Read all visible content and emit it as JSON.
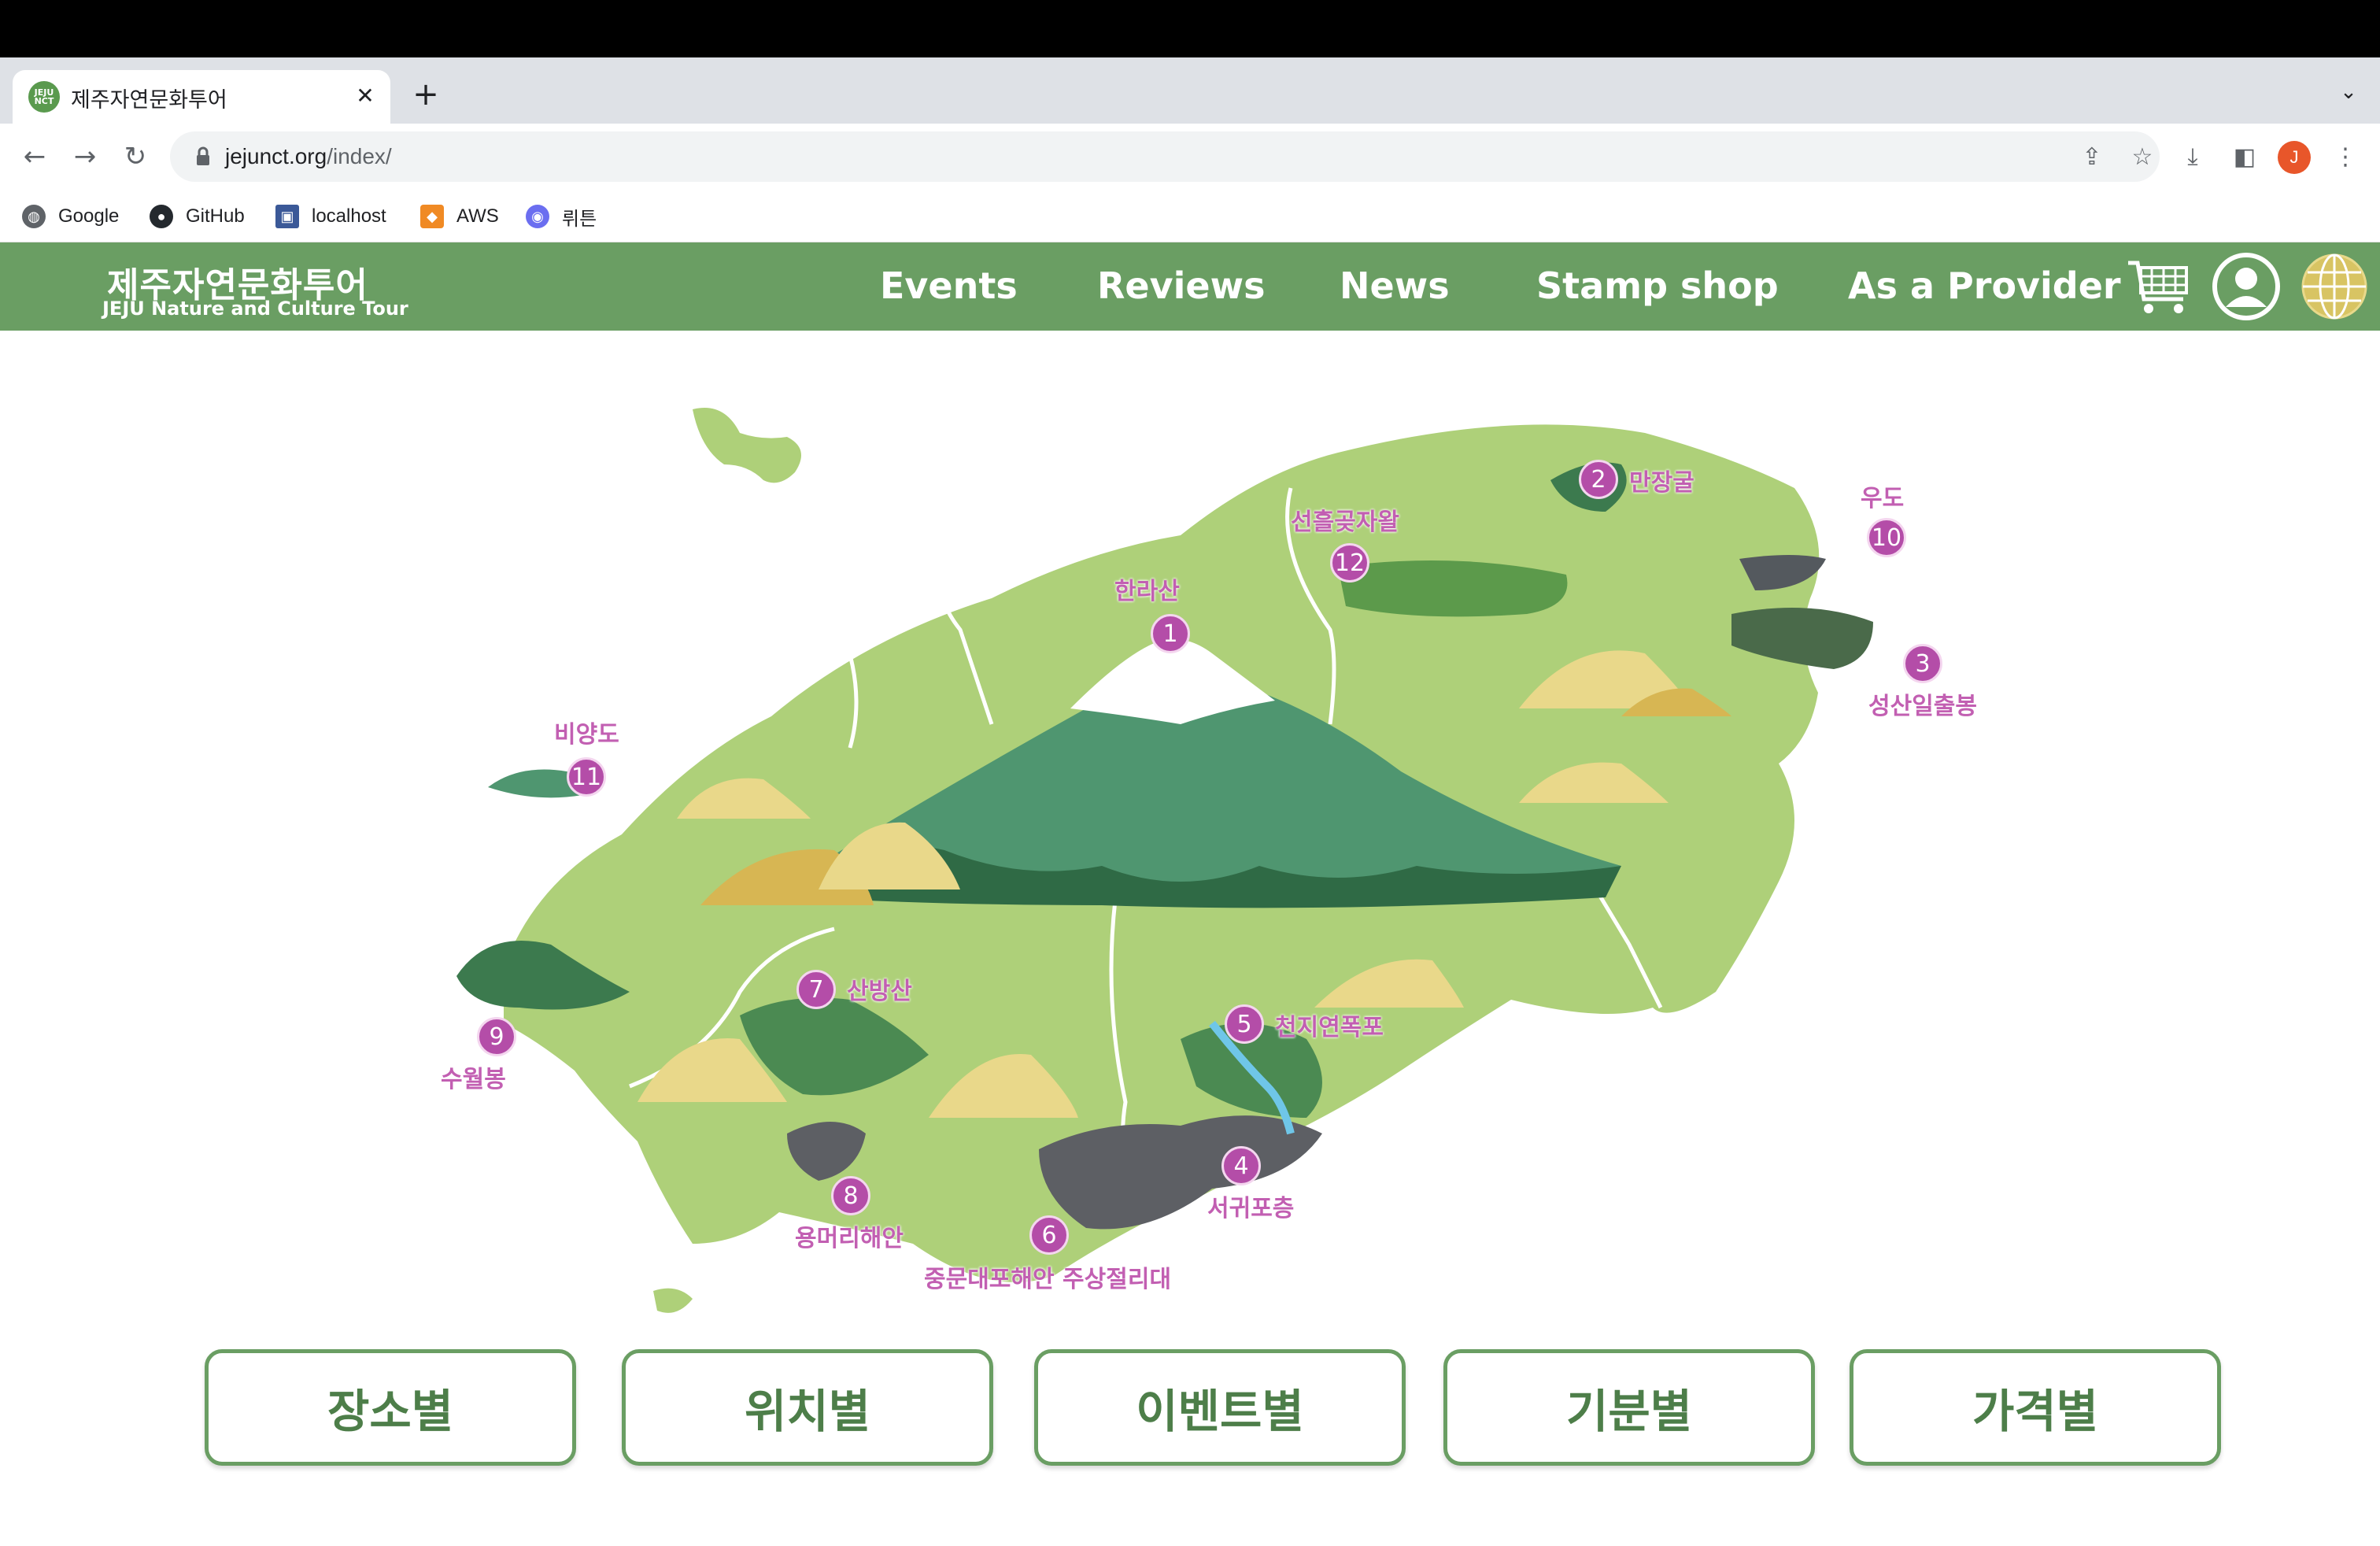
{
  "browser": {
    "tab": {
      "title": "제주자연문화투어",
      "favicon_text": "JEJU NCT"
    },
    "url": {
      "host": "jejunct.org",
      "path": "/index/"
    },
    "profile_initial": "J",
    "bookmarks": [
      {
        "label": "Google",
        "icon": "globe-icon",
        "color": "#5f6368"
      },
      {
        "label": "GitHub",
        "icon": "github-icon",
        "color": "#24292e"
      },
      {
        "label": "localhost",
        "icon": "localhost-icon",
        "color": "#3b5998"
      },
      {
        "label": "AWS",
        "icon": "aws-icon",
        "color": "#f08a24"
      },
      {
        "label": "뤼튼",
        "icon": "wrtn-icon",
        "color": "#6b6ef0"
      }
    ]
  },
  "site": {
    "logo_kr": "제주자연문화투어",
    "logo_en": "JEJU Nature and Culture Tour",
    "nav": [
      "Events",
      "Reviews",
      "News",
      "Stamp shop",
      "As a Provider"
    ],
    "icons": [
      "cart-icon",
      "account-icon",
      "language-globe-icon"
    ],
    "brand_color": "#6a9e63"
  },
  "map": {
    "places": [
      {
        "num": "1",
        "label": "한라산"
      },
      {
        "num": "2",
        "label": "만장굴"
      },
      {
        "num": "3",
        "label": "성산일출봉"
      },
      {
        "num": "4",
        "label": "서귀포층"
      },
      {
        "num": "5",
        "label": "천지연폭포"
      },
      {
        "num": "6",
        "label": "중문대포해안 주상절리대"
      },
      {
        "num": "7",
        "label": "산방산"
      },
      {
        "num": "8",
        "label": "용머리해안"
      },
      {
        "num": "9",
        "label": "수월봉"
      },
      {
        "num": "10",
        "label": "우도"
      },
      {
        "num": "11",
        "label": "비양도"
      },
      {
        "num": "12",
        "label": "선흘곶자왈"
      }
    ]
  },
  "filters": [
    "장소별",
    "위치별",
    "이벤트별",
    "기분별",
    "가격별"
  ]
}
